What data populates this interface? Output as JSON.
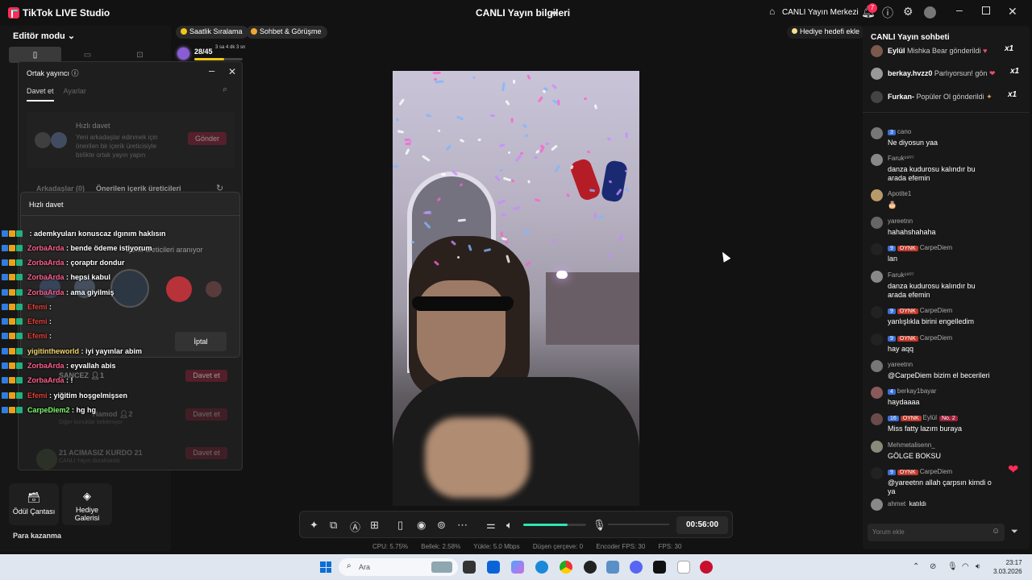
{
  "titlebar": {
    "app_name": "TikTok LIVE Studio",
    "center_title": "CANLI Yayın bilgileri",
    "live_center": "CANLI Yayın Merkezi",
    "notif_count": "7"
  },
  "left": {
    "editor_mode": "Editör modu",
    "tools": [
      {
        "label": "Ödül Çantası"
      },
      {
        "label": "Hediye Galerisi"
      }
    ],
    "para": "Para kazanma"
  },
  "pills": {
    "hourly": "Saatlik Sıralama",
    "chat_meet": "Sohbet & Görüşme",
    "gift_goal": "Hediye hedefi ekle"
  },
  "goal": {
    "count": "28/45",
    "time": "3 sa 4 dk 3 sn",
    "progress": 0.62
  },
  "cohost": {
    "title": "Ortak yayıncı",
    "tabs": [
      "Davet et",
      "Ayarlar"
    ],
    "quick_title": "Hızlı davet",
    "quick_desc": "Yeni arkadaşlar edinmek için önerilen bir içerik üreticisiyle birlikte ortak yayın yapın",
    "send": "Gönder",
    "friends_tab": "Arkadaşlar (0)",
    "suggested_tab": "Önerilen içerik üreticileri",
    "rows": [
      {
        "name": "SANCEZ",
        "sub": "",
        "count": "1",
        "btn": "Davet et"
      },
      {
        "name": "Hamod",
        "sub": "Diğer konuklar bekleniyor",
        "count": "2",
        "btn": "Davet et"
      },
      {
        "name": "21 ACIMASIZ KURDO 21",
        "sub": "CANLI Yayın duraklatıldı",
        "count": "",
        "btn": "Davet et"
      }
    ]
  },
  "quick_invite": {
    "title": "Hızlı davet",
    "sub": "İçerik üreticileri aranıyor",
    "cancel": "İptal"
  },
  "overlay_chat": [
    {
      "user": "",
      "text": "ademkyuları konuscaz ılgınım haklısın",
      "color": "#ff5f8f"
    },
    {
      "user": "ZorbaArda",
      "text": "bende ödeme istiyorum",
      "color": "#ff5f8f"
    },
    {
      "user": "ZorbaArda",
      "text": "çoraptır dondur",
      "color": "#ff5f8f"
    },
    {
      "user": "ZorbaArda",
      "text": "hepsi kabul",
      "color": "#ff5f8f"
    },
    {
      "user": "ZorbaArda",
      "text": "ama giyilmiş",
      "color": "#ff5f8f"
    },
    {
      "user": "Efemi",
      "text": "",
      "color": "#e0413a"
    },
    {
      "user": "Efemi",
      "text": "",
      "color": "#e0413a"
    },
    {
      "user": "Efemi",
      "text": "",
      "color": "#e0413a"
    },
    {
      "user": "yigitintheworld",
      "text": "iyi yayınlar abim",
      "color": "#f5d76e"
    },
    {
      "user": "ZorbaArda",
      "text": "eyvallah abis",
      "color": "#ff5f8f"
    },
    {
      "user": "ZorbaArda",
      "text": "!",
      "color": "#ff5f8f"
    },
    {
      "user": "Efemi",
      "text": "yiğitim hoşgelmişsen",
      "color": "#e0413a"
    },
    {
      "user": "CarpeDiem2",
      "text": "hg hg",
      "color": "#7cfc6a"
    }
  ],
  "toolbar": {
    "timer": "00:56:00",
    "volume": 0.7
  },
  "stats": {
    "cpu": "CPU: 5.75%",
    "mem": "Bellek: 2.58%",
    "upload": "Yükle: 5.0 Mbps",
    "dropped": "Düşen çerçeve: 0",
    "encoder_fps": "Encoder FPS: 30",
    "fps": "FPS: 30"
  },
  "chat": {
    "title": "CANLI Yayın sohbeti",
    "gifts": [
      {
        "user": "Eylül",
        "text": "Mishka Bear gönderildi",
        "count": "x1"
      },
      {
        "user": "berkay.hvzz0",
        "text": "Parlıyorsun! gön",
        "count": "x1"
      },
      {
        "user": "Furkan-",
        "text": "Popüler Ol gönderildi",
        "count": "x1"
      }
    ],
    "messages": [
      {
        "level": "3",
        "fan": "",
        "user": "cano",
        "text": "Ne diyosun yaa"
      },
      {
        "level": "",
        "fan": "",
        "user": "Faruk¹⁹⁰⁷",
        "text": "danza kudurosu kalındır bu arada efemin"
      },
      {
        "level": "",
        "fan": "",
        "user": "Apotite1",
        "text": "🎂"
      },
      {
        "level": "",
        "fan": "",
        "user": "yareetnn",
        "text": "hahahshahaha"
      },
      {
        "level": "9",
        "fan": "OYNK",
        "user": "CarpeDiem",
        "text": "lan"
      },
      {
        "level": "",
        "fan": "",
        "user": "Faruk¹⁹⁰⁷",
        "text": "danza kudurosu kalındır bu arada efemin"
      },
      {
        "level": "9",
        "fan": "OYNK",
        "user": "CarpeDiem",
        "text": "yanlışlıkla birini engelledim"
      },
      {
        "level": "9",
        "fan": "OYNK",
        "user": "CarpeDiem",
        "text": "hay aqq"
      },
      {
        "level": "",
        "fan": "",
        "user": "yareetnn",
        "text": "@CarpeDiem bizim el becerileri"
      },
      {
        "level": "4",
        "fan": "",
        "user": "berkay1bayar",
        "text": "haydaaaa"
      },
      {
        "level": "16",
        "fan": "OYNK",
        "user": "Eylül",
        "text": "Miss fatty lazım buraya",
        "extra": "No. 2"
      },
      {
        "level": "",
        "fan": "",
        "user": "Mehmetalisenn_",
        "text": "GÖLGE BOKSU"
      },
      {
        "level": "9",
        "fan": "OYNK",
        "user": "CarpeDiem",
        "text": "@yareetnn allah çarpsın kimdi o ya"
      }
    ],
    "join_user": "ahmet",
    "join_text": "katıldı",
    "input_placeholder": "Yorum ekle"
  },
  "taskbar": {
    "search": "Ara",
    "time": "23:17",
    "date": "3.03.2026"
  }
}
